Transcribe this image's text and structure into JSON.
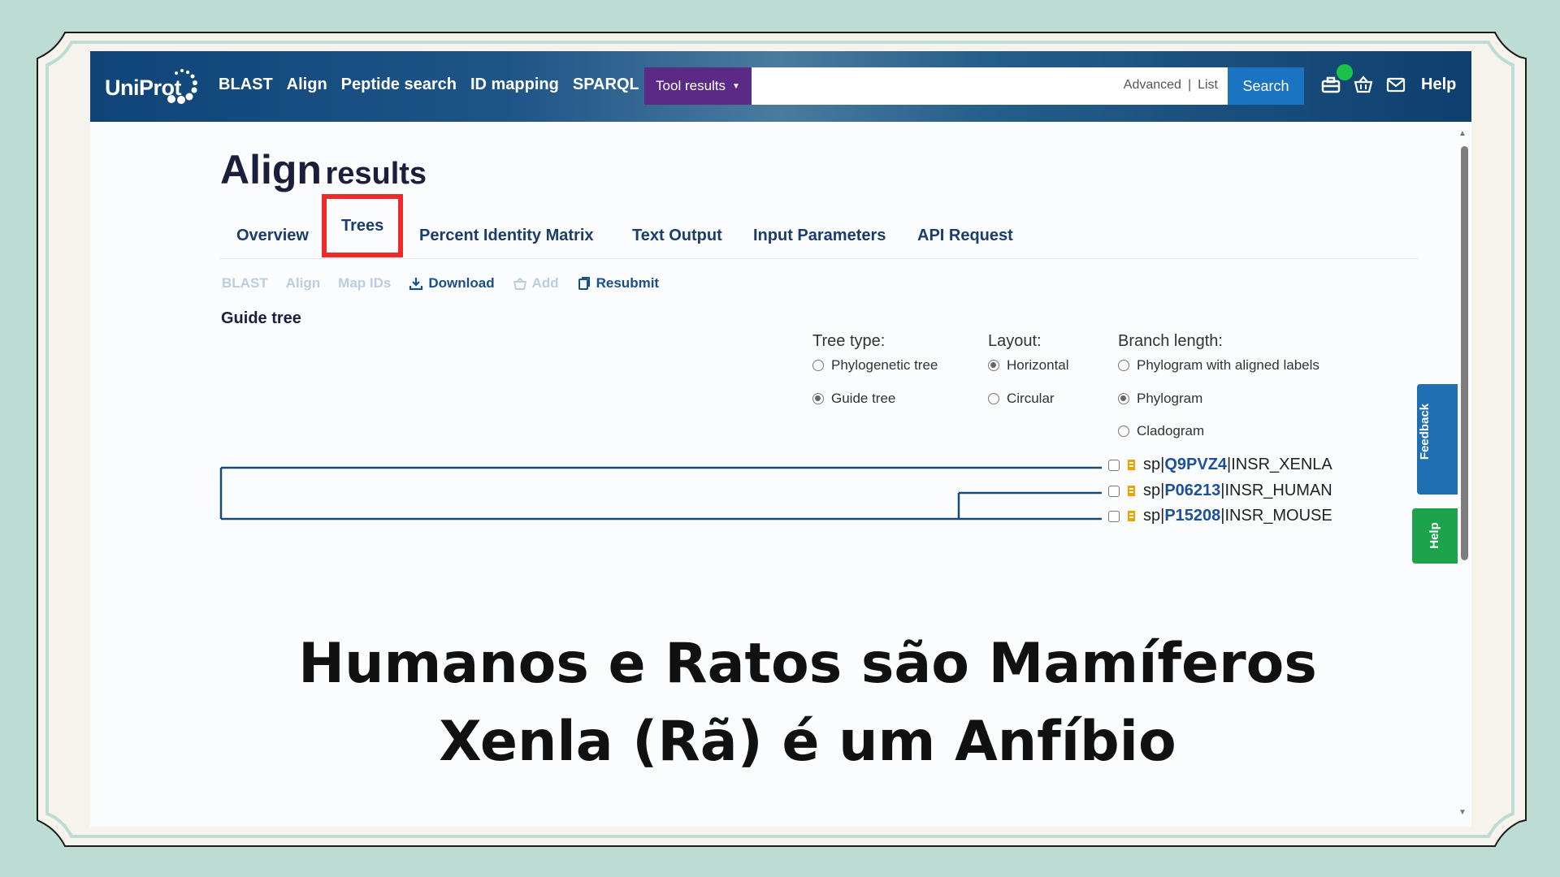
{
  "header": {
    "logo_text": "UniProt",
    "nav": [
      "BLAST",
      "Align",
      "Peptide search",
      "ID mapping",
      "SPARQL"
    ],
    "tool_results": "Tool results",
    "search_value": "",
    "advanced": "Advanced",
    "list": "List",
    "search_button": "Search",
    "help": "Help"
  },
  "page": {
    "title_main": "Align",
    "title_sub": "results",
    "tabs": [
      "Overview",
      "Trees",
      "Percent Identity Matrix",
      "Text Output",
      "Input Parameters",
      "API Request"
    ],
    "active_tab": "Trees",
    "actions": {
      "blast": "BLAST",
      "align": "Align",
      "map_ids": "Map IDs",
      "download": "Download",
      "add": "Add",
      "resubmit": "Resubmit"
    },
    "guide_tree_label": "Guide tree"
  },
  "tree_options": {
    "tree_type": {
      "label": "Tree type:",
      "options": [
        "Phylogenetic tree",
        "Guide tree"
      ],
      "selected": "Guide tree"
    },
    "layout": {
      "label": "Layout:",
      "options": [
        "Horizontal",
        "Circular"
      ],
      "selected": "Horizontal"
    },
    "branch_length": {
      "label": "Branch length:",
      "options": [
        "Phylogram with aligned labels",
        "Phylogram",
        "Cladogram"
      ],
      "selected": "Phylogram"
    }
  },
  "tree_leaves": [
    {
      "db": "sp|",
      "accession": "Q9PVZ4",
      "name": "|INSR_XENLA"
    },
    {
      "db": "sp|",
      "accession": "P06213",
      "name": "|INSR_HUMAN"
    },
    {
      "db": "sp|",
      "accession": "P15208",
      "name": "|INSR_MOUSE"
    }
  ],
  "side_tabs": {
    "feedback": "Feedback",
    "help": "Help"
  },
  "caption": {
    "line1": "Humanos e Ratos são Mamíferos",
    "line2": "Xenla (Rã) é um Anfíbio"
  },
  "colors": {
    "frame_bg": "#bcdcd4",
    "header_dark": "#0f4478",
    "tool_results_bg": "#5b2a86",
    "search_button_bg": "#1a74c2",
    "highlight_red": "#ee2b2b",
    "feedback_bg": "#1f6fb2",
    "help_bg": "#1da34c",
    "tree_line": "#1a4a78"
  }
}
